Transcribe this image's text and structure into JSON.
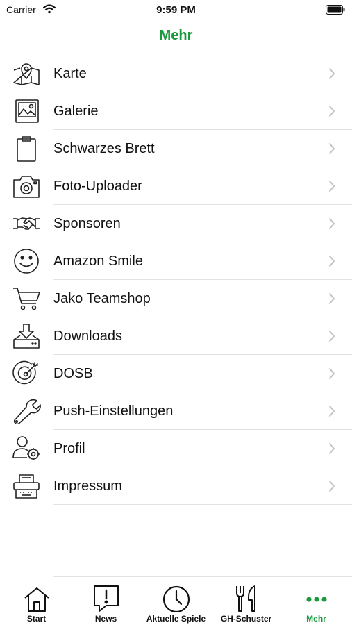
{
  "status_bar": {
    "carrier": "Carrier",
    "time": "9:59 PM"
  },
  "nav": {
    "title": "Mehr"
  },
  "menu": [
    {
      "label": "Karte",
      "icon": "map-pin-icon"
    },
    {
      "label": "Galerie",
      "icon": "gallery-image-icon"
    },
    {
      "label": "Schwarzes Brett",
      "icon": "clipboard-icon"
    },
    {
      "label": "Foto-Uploader",
      "icon": "camera-icon"
    },
    {
      "label": "Sponsoren",
      "icon": "handshake-icon"
    },
    {
      "label": "Amazon Smile",
      "icon": "smiley-icon"
    },
    {
      "label": "Jako Teamshop",
      "icon": "shopping-cart-icon"
    },
    {
      "label": "Downloads",
      "icon": "download-tray-icon"
    },
    {
      "label": "DOSB",
      "icon": "target-icon"
    },
    {
      "label": "Push-Einstellungen",
      "icon": "wrench-icon"
    },
    {
      "label": "Profil",
      "icon": "user-settings-icon"
    },
    {
      "label": "Impressum",
      "icon": "typewriter-icon"
    }
  ],
  "tabs": [
    {
      "label": "Start",
      "icon": "home-icon"
    },
    {
      "label": "News",
      "icon": "news-alert-icon"
    },
    {
      "label": "Aktuelle Spiele",
      "icon": "clock-icon"
    },
    {
      "label": "GH-Schuster",
      "icon": "restaurant-icon"
    },
    {
      "label": "Mehr",
      "icon": "more-dots-icon"
    }
  ],
  "colors": {
    "accent": "#1a9a3c",
    "text": "#111111",
    "separator": "#e2e2e2",
    "chevron": "#c4c4c6"
  }
}
